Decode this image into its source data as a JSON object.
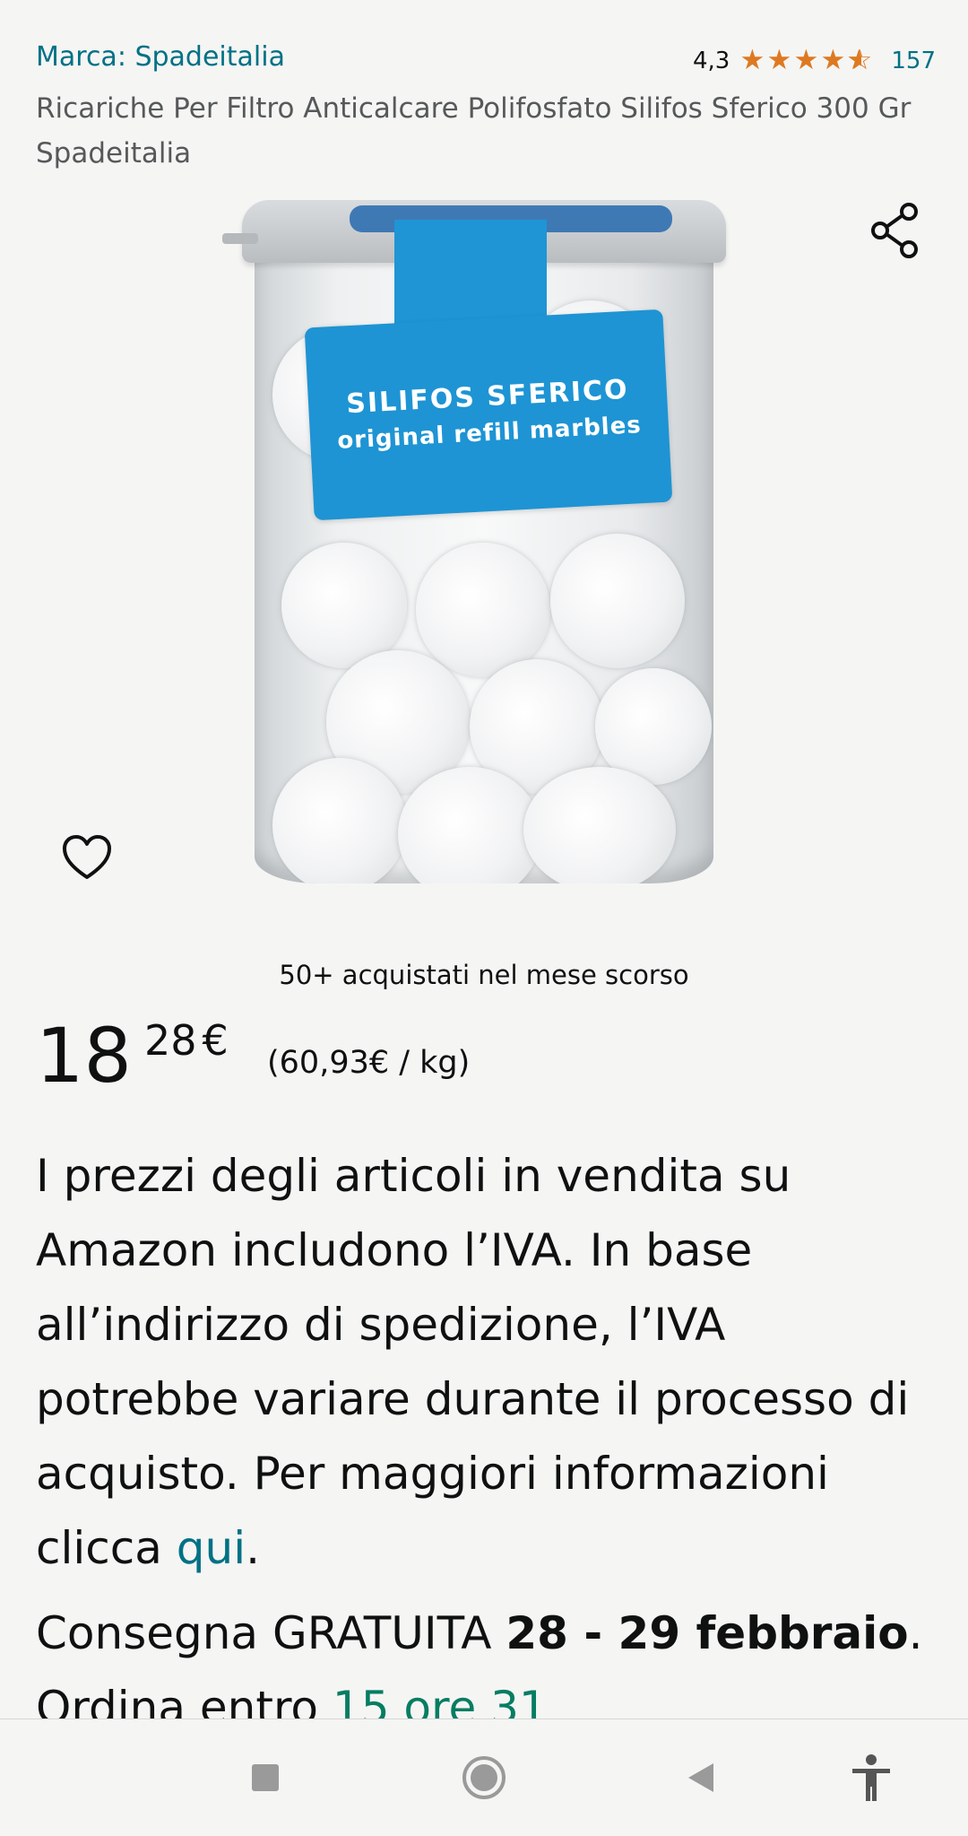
{
  "product": {
    "brand_label": "Marca: Spadeitalia",
    "rating_value": "4,3",
    "rating_stars": 4.3,
    "rating_count": "157",
    "title": "Ricariche Per Filtro Anticalcare Polifosfato Silifos Sferico 300 Gr Spadeitalia",
    "image": {
      "label_line1": "SILIFOS SFERICO",
      "label_line2": "original refill marbles"
    }
  },
  "actions": {
    "share_icon": "share-icon",
    "wishlist_icon": "heart-outline-icon"
  },
  "sales": {
    "bought_text": "50+ acquistati nel mese scorso"
  },
  "price": {
    "whole": "18",
    "fraction": "28",
    "currency": "€",
    "unit_price": "(60,93€ / kg)"
  },
  "vat_notice": {
    "text": "I prezzi degli articoli in vendita su Amazon includono l’IVA. In base all’indirizzo di spedizione, l’IVA potrebbe variare durante il processo di acquisto. Per maggiori informazioni clicca ",
    "link_text": "qui",
    "suffix": "."
  },
  "delivery": {
    "prefix": "Consegna GRATUITA ",
    "dates": "28 - 29 febbraio",
    "middle": ". Ordina entro ",
    "deadline": "15 ore 31"
  },
  "navbar": {
    "buttons": [
      "recent-apps-icon",
      "home-icon",
      "back-icon",
      "accessibility-icon"
    ]
  },
  "colors": {
    "link": "#007185",
    "star": "#de7921",
    "deadline": "#067d62",
    "background": "#f5f5f4"
  }
}
